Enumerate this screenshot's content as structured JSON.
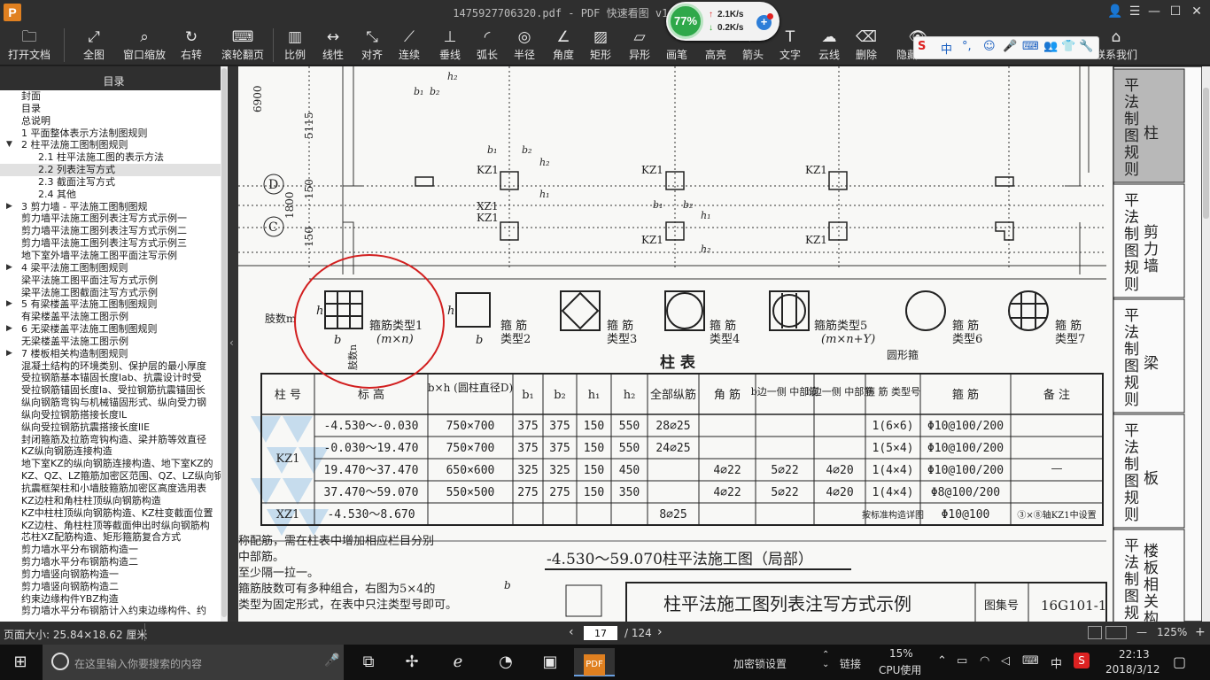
{
  "window": {
    "logo": "P",
    "title": "1475927706320.pdf - PDF 快速看图 v1.9",
    "controls": [
      "👤",
      "☰",
      "—",
      "☐",
      "✕"
    ]
  },
  "toolbar": {
    "buttons": [
      {
        "label": "打开文档",
        "icon": "🗀"
      },
      {
        "label": "全图",
        "icon": "⤢"
      },
      {
        "label": "窗口缩放",
        "icon": "⌕"
      },
      {
        "label": "右转",
        "icon": "↻"
      },
      {
        "label": "滚轮翻页",
        "icon": "⌨"
      },
      {
        "label": "比例",
        "icon": "▥"
      },
      {
        "label": "线性",
        "icon": "↔"
      },
      {
        "label": "对齐",
        "icon": "⤡"
      },
      {
        "label": "连续",
        "icon": "⟋"
      },
      {
        "label": "垂线",
        "icon": "⊥"
      },
      {
        "label": "弧长",
        "icon": "◜"
      },
      {
        "label": "半径",
        "icon": "◎"
      },
      {
        "label": "角度",
        "icon": "∠"
      },
      {
        "label": "矩形",
        "icon": "▨"
      },
      {
        "label": "异形",
        "icon": "▱"
      },
      {
        "label": "画笔",
        "icon": "✎"
      },
      {
        "label": "高亮",
        "icon": "▬"
      },
      {
        "label": "箭头",
        "icon": "➚"
      },
      {
        "label": "文字",
        "icon": "T"
      },
      {
        "label": "云线",
        "icon": "☁"
      },
      {
        "label": "删除",
        "icon": "⌫"
      },
      {
        "label": "隐藏标注",
        "icon": "👁"
      },
      {
        "label": "联系我们",
        "icon": "⌂"
      }
    ]
  },
  "speed_widget": {
    "percent": "77%",
    "up": "2.1K/s",
    "down": "0.2K/s",
    "up_arrow": "↑",
    "down_arrow": "↓",
    "plus": "+"
  },
  "ime": {
    "items": [
      "S",
      "中",
      "°,",
      "☺",
      "🎤",
      "⌨",
      "👥",
      "👕",
      "🔧"
    ]
  },
  "sidebar": {
    "title": "目录",
    "items": [
      {
        "label": "封面",
        "indent": 1
      },
      {
        "label": "目录",
        "indent": 1
      },
      {
        "label": "总说明",
        "indent": 1
      },
      {
        "label": "1 平面整体表示方法制图规则",
        "indent": 1
      },
      {
        "label": "2 柱平法施工图制图规则",
        "indent": 1,
        "arrow": "▼"
      },
      {
        "label": "2.1 柱平法施工图的表示方法",
        "indent": 2
      },
      {
        "label": "2.2 列表注写方式",
        "indent": 2,
        "selected": true
      },
      {
        "label": "2.3 截面注写方式",
        "indent": 2
      },
      {
        "label": "2.4 其他",
        "indent": 2
      },
      {
        "label": "3 剪力墙 - 平法施工图制图规",
        "indent": 1,
        "arrow": "▶"
      },
      {
        "label": "剪力墙平法施工图列表注写方式示例一",
        "indent": 1
      },
      {
        "label": "剪力墙平法施工图列表注写方式示例二",
        "indent": 1
      },
      {
        "label": "剪力墙平法施工图列表注写方式示例三",
        "indent": 1
      },
      {
        "label": "地下室外墙平法施工图平面注写示例",
        "indent": 1
      },
      {
        "label": "4 梁平法施工图制图规则",
        "indent": 1,
        "arrow": "▶"
      },
      {
        "label": "梁平法施工图平面注写方式示例",
        "indent": 1
      },
      {
        "label": "梁平法施工图截面注写方式示例",
        "indent": 1
      },
      {
        "label": "5 有梁楼盖平法施工图制图规则",
        "indent": 1,
        "arrow": "▶"
      },
      {
        "label": "有梁楼盖平法施工图示例",
        "indent": 1
      },
      {
        "label": "6 无梁楼盖平法施工图制图规则",
        "indent": 1,
        "arrow": "▶"
      },
      {
        "label": "无梁楼盖平法施工图示例",
        "indent": 1
      },
      {
        "label": "7 楼板相关构造制图规则",
        "indent": 1,
        "arrow": "▶"
      },
      {
        "label": "混凝土结构的环境类别、保护层的最小厚度",
        "indent": 1
      },
      {
        "label": "受拉钢筋基本锚固长度lab、抗震设计时受",
        "indent": 1
      },
      {
        "label": "受拉钢筋锚固长度la、受拉钢筋抗震锚固长",
        "indent": 1
      },
      {
        "label": "纵向钢筋弯钩与机械锚固形式、纵向受力钢",
        "indent": 1
      },
      {
        "label": "纵向受拉钢筋搭接长度lL",
        "indent": 1
      },
      {
        "label": "纵向受拉钢筋抗震搭接长度llE",
        "indent": 1
      },
      {
        "label": "封闭箍筋及拉筋弯钩构造、梁并筋等效直径",
        "indent": 1
      },
      {
        "label": "KZ纵向钢筋连接构造",
        "indent": 1
      },
      {
        "label": "地下室KZ的纵向钢筋连接构造、地下室KZ的",
        "indent": 1
      },
      {
        "label": "KZ、QZ、LZ箍筋加密区范围、QZ、LZ纵向钢",
        "indent": 1
      },
      {
        "label": "抗震框架柱和小墙肢箍筋加密区高度选用表",
        "indent": 1
      },
      {
        "label": "KZ边柱和角柱柱顶纵向钢筋构造",
        "indent": 1
      },
      {
        "label": "KZ中柱柱顶纵向钢筋构造、KZ柱变截面位置",
        "indent": 1
      },
      {
        "label": "KZ边柱、角柱柱顶等截面伸出时纵向钢筋构",
        "indent": 1
      },
      {
        "label": "芯柱XZ配筋构造、矩形箍筋复合方式",
        "indent": 1
      },
      {
        "label": "剪力墙水平分布钢筋构造一",
        "indent": 1
      },
      {
        "label": "剪力墙水平分布钢筋构造二",
        "indent": 1
      },
      {
        "label": "剪力墙竖向钢筋构造一",
        "indent": 1
      },
      {
        "label": "剪力墙竖向钢筋构造二",
        "indent": 1
      },
      {
        "label": "约束边缘构件YBZ构造",
        "indent": 1
      },
      {
        "label": "剪力墙水平分布钢筋计入约束边缘构件、约",
        "indent": 1
      }
    ]
  },
  "drawing": {
    "dims": [
      "6900",
      "5115",
      "1800",
      "150",
      "150"
    ],
    "axes": [
      "D",
      "C"
    ],
    "col_labels": [
      "KZ1",
      "XZ1",
      "KZ1",
      "KZ1",
      "KZ1",
      "KZ1",
      "KZ1"
    ],
    "b1": "b₁",
    "b2": "b₂",
    "h1": "h₁",
    "h2": "h₂",
    "stirrup_labels": [
      {
        "l1": "箍筋类型1",
        "l2": "(m×n)"
      },
      {
        "l1": "箍 筋",
        "l2": "类型2"
      },
      {
        "l1": "箍 筋",
        "l2": "类型3"
      },
      {
        "l1": "箍 筋",
        "l2": "类型4"
      },
      {
        "l1": "箍筋类型5",
        "l2": "(m×n+Y)"
      },
      {
        "l1": "箍 筋",
        "l2": "类型6"
      },
      {
        "l1": "箍 筋",
        "l2": "类型7"
      }
    ],
    "round_stirrup": "圆形箍",
    "limbs_m": "肢数m",
    "limbs_n": "肢数n",
    "b": "b",
    "h": "h",
    "table_title": "柱 表",
    "headers": [
      "柱 号",
      "标 高",
      "b×h (圆柱直径D)",
      "b₁",
      "b₂",
      "h₁",
      "h₂",
      "全部纵筋",
      "角 筋",
      "b边一侧 中部筋",
      "h边一侧 中部筋",
      "箍 筋 类型号",
      "箍 筋",
      "备 注"
    ],
    "rows": [
      [
        "-4.530～-0.030",
        "750×700",
        "375",
        "375",
        "150",
        "550",
        "28⌀25",
        "",
        "",
        "",
        "1(6×6)",
        "Φ10@100/200"
      ],
      [
        "-0.030～19.470",
        "750×700",
        "375",
        "375",
        "150",
        "550",
        "24⌀25",
        "",
        "",
        "",
        "1(5×4)",
        "Φ10@100/200"
      ],
      [
        "19.470～37.470",
        "650×600",
        "325",
        "325",
        "150",
        "450",
        "",
        "4⌀22",
        "5⌀22",
        "4⌀20",
        "1(4×4)",
        "Φ10@100/200"
      ],
      [
        "37.470～59.070",
        "550×500",
        "275",
        "275",
        "150",
        "350",
        "",
        "4⌀22",
        "5⌀22",
        "4⌀20",
        "1(4×4)",
        "Φ8@100/200"
      ],
      [
        "-4.530～8.670",
        "",
        "",
        "",
        "",
        "",
        "8⌀25",
        "",
        "",
        "",
        "按标准构造详图",
        "Φ10@100"
      ]
    ],
    "kz1": "KZ1",
    "xz1": "XZ1",
    "remark_dash": "—",
    "remark_xz": "③×⑧轴KZ1中设置",
    "plan_title": "-4.530～59.070柱平法施工图（局部）",
    "notes": [
      "称配筋，需在柱表中增加相应栏目分别",
      "中部筋。",
      "至少隔一拉一。",
      "箍筋肢数可有多种组合，右图为5×4的",
      "类型为固定形式，在表中只注类型号即可。"
    ],
    "box_title": "柱平法施工图列表注写方式示例",
    "atlas_label": "图集号",
    "atlas_no": "16G101-1"
  },
  "right_tabs": [
    {
      "main": "平法制图规则",
      "sub": "柱",
      "active": true
    },
    {
      "main": "平法制图规则",
      "sub": "剪力墙"
    },
    {
      "main": "平法制图规则",
      "sub": "梁"
    },
    {
      "main": "平法制图规则",
      "sub": "板"
    },
    {
      "main": "平法制图规则",
      "sub": "楼板相关构"
    }
  ],
  "status": {
    "page_size": "页面大小: 25.84×18.62 厘米",
    "page_current": "17",
    "page_total": "/ 124",
    "zoom": "125%",
    "prev": "‹",
    "next": "›",
    "minus": "—",
    "plus": "+"
  },
  "taskbar": {
    "search_placeholder": "在这里输入你要搜索的内容",
    "tray_text1": "加密锁设置",
    "tray_link": "链接",
    "cpu": "15%",
    "cpu_label": "CPU使用",
    "lang": "中",
    "time": "22:13",
    "date": "2018/3/12"
  },
  "colors": {
    "accent_red": "#d21f1f",
    "app_orange": "#e08020",
    "green": "#2fa84a"
  }
}
